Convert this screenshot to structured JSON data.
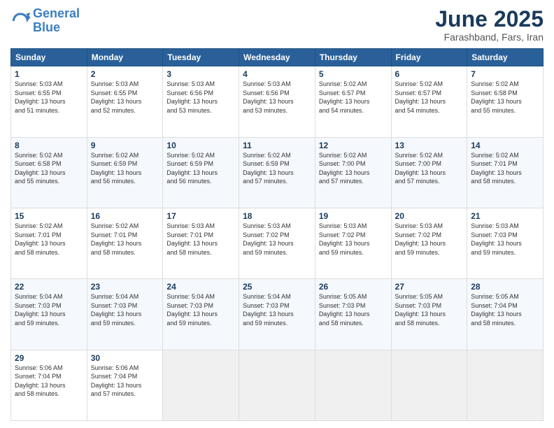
{
  "logo": {
    "line1": "General",
    "line2": "Blue"
  },
  "title": "June 2025",
  "location": "Farashband, Fars, Iran",
  "days_header": [
    "Sunday",
    "Monday",
    "Tuesday",
    "Wednesday",
    "Thursday",
    "Friday",
    "Saturday"
  ],
  "weeks": [
    [
      {
        "day": 1,
        "lines": [
          "Sunrise: 5:03 AM",
          "Sunset: 6:55 PM",
          "Daylight: 13 hours",
          "and 51 minutes."
        ]
      },
      {
        "day": 2,
        "lines": [
          "Sunrise: 5:03 AM",
          "Sunset: 6:55 PM",
          "Daylight: 13 hours",
          "and 52 minutes."
        ]
      },
      {
        "day": 3,
        "lines": [
          "Sunrise: 5:03 AM",
          "Sunset: 6:56 PM",
          "Daylight: 13 hours",
          "and 53 minutes."
        ]
      },
      {
        "day": 4,
        "lines": [
          "Sunrise: 5:03 AM",
          "Sunset: 6:56 PM",
          "Daylight: 13 hours",
          "and 53 minutes."
        ]
      },
      {
        "day": 5,
        "lines": [
          "Sunrise: 5:02 AM",
          "Sunset: 6:57 PM",
          "Daylight: 13 hours",
          "and 54 minutes."
        ]
      },
      {
        "day": 6,
        "lines": [
          "Sunrise: 5:02 AM",
          "Sunset: 6:57 PM",
          "Daylight: 13 hours",
          "and 54 minutes."
        ]
      },
      {
        "day": 7,
        "lines": [
          "Sunrise: 5:02 AM",
          "Sunset: 6:58 PM",
          "Daylight: 13 hours",
          "and 55 minutes."
        ]
      }
    ],
    [
      {
        "day": 8,
        "lines": [
          "Sunrise: 5:02 AM",
          "Sunset: 6:58 PM",
          "Daylight: 13 hours",
          "and 55 minutes."
        ]
      },
      {
        "day": 9,
        "lines": [
          "Sunrise: 5:02 AM",
          "Sunset: 6:59 PM",
          "Daylight: 13 hours",
          "and 56 minutes."
        ]
      },
      {
        "day": 10,
        "lines": [
          "Sunrise: 5:02 AM",
          "Sunset: 6:59 PM",
          "Daylight: 13 hours",
          "and 56 minutes."
        ]
      },
      {
        "day": 11,
        "lines": [
          "Sunrise: 5:02 AM",
          "Sunset: 6:59 PM",
          "Daylight: 13 hours",
          "and 57 minutes."
        ]
      },
      {
        "day": 12,
        "lines": [
          "Sunrise: 5:02 AM",
          "Sunset: 7:00 PM",
          "Daylight: 13 hours",
          "and 57 minutes."
        ]
      },
      {
        "day": 13,
        "lines": [
          "Sunrise: 5:02 AM",
          "Sunset: 7:00 PM",
          "Daylight: 13 hours",
          "and 57 minutes."
        ]
      },
      {
        "day": 14,
        "lines": [
          "Sunrise: 5:02 AM",
          "Sunset: 7:01 PM",
          "Daylight: 13 hours",
          "and 58 minutes."
        ]
      }
    ],
    [
      {
        "day": 15,
        "lines": [
          "Sunrise: 5:02 AM",
          "Sunset: 7:01 PM",
          "Daylight: 13 hours",
          "and 58 minutes."
        ]
      },
      {
        "day": 16,
        "lines": [
          "Sunrise: 5:02 AM",
          "Sunset: 7:01 PM",
          "Daylight: 13 hours",
          "and 58 minutes."
        ]
      },
      {
        "day": 17,
        "lines": [
          "Sunrise: 5:03 AM",
          "Sunset: 7:01 PM",
          "Daylight: 13 hours",
          "and 58 minutes."
        ]
      },
      {
        "day": 18,
        "lines": [
          "Sunrise: 5:03 AM",
          "Sunset: 7:02 PM",
          "Daylight: 13 hours",
          "and 59 minutes."
        ]
      },
      {
        "day": 19,
        "lines": [
          "Sunrise: 5:03 AM",
          "Sunset: 7:02 PM",
          "Daylight: 13 hours",
          "and 59 minutes."
        ]
      },
      {
        "day": 20,
        "lines": [
          "Sunrise: 5:03 AM",
          "Sunset: 7:02 PM",
          "Daylight: 13 hours",
          "and 59 minutes."
        ]
      },
      {
        "day": 21,
        "lines": [
          "Sunrise: 5:03 AM",
          "Sunset: 7:03 PM",
          "Daylight: 13 hours",
          "and 59 minutes."
        ]
      }
    ],
    [
      {
        "day": 22,
        "lines": [
          "Sunrise: 5:04 AM",
          "Sunset: 7:03 PM",
          "Daylight: 13 hours",
          "and 59 minutes."
        ]
      },
      {
        "day": 23,
        "lines": [
          "Sunrise: 5:04 AM",
          "Sunset: 7:03 PM",
          "Daylight: 13 hours",
          "and 59 minutes."
        ]
      },
      {
        "day": 24,
        "lines": [
          "Sunrise: 5:04 AM",
          "Sunset: 7:03 PM",
          "Daylight: 13 hours",
          "and 59 minutes."
        ]
      },
      {
        "day": 25,
        "lines": [
          "Sunrise: 5:04 AM",
          "Sunset: 7:03 PM",
          "Daylight: 13 hours",
          "and 59 minutes."
        ]
      },
      {
        "day": 26,
        "lines": [
          "Sunrise: 5:05 AM",
          "Sunset: 7:03 PM",
          "Daylight: 13 hours",
          "and 58 minutes."
        ]
      },
      {
        "day": 27,
        "lines": [
          "Sunrise: 5:05 AM",
          "Sunset: 7:03 PM",
          "Daylight: 13 hours",
          "and 58 minutes."
        ]
      },
      {
        "day": 28,
        "lines": [
          "Sunrise: 5:05 AM",
          "Sunset: 7:04 PM",
          "Daylight: 13 hours",
          "and 58 minutes."
        ]
      }
    ],
    [
      {
        "day": 29,
        "lines": [
          "Sunrise: 5:06 AM",
          "Sunset: 7:04 PM",
          "Daylight: 13 hours",
          "and 58 minutes."
        ]
      },
      {
        "day": 30,
        "lines": [
          "Sunrise: 5:06 AM",
          "Sunset: 7:04 PM",
          "Daylight: 13 hours",
          "and 57 minutes."
        ]
      },
      null,
      null,
      null,
      null,
      null
    ]
  ]
}
